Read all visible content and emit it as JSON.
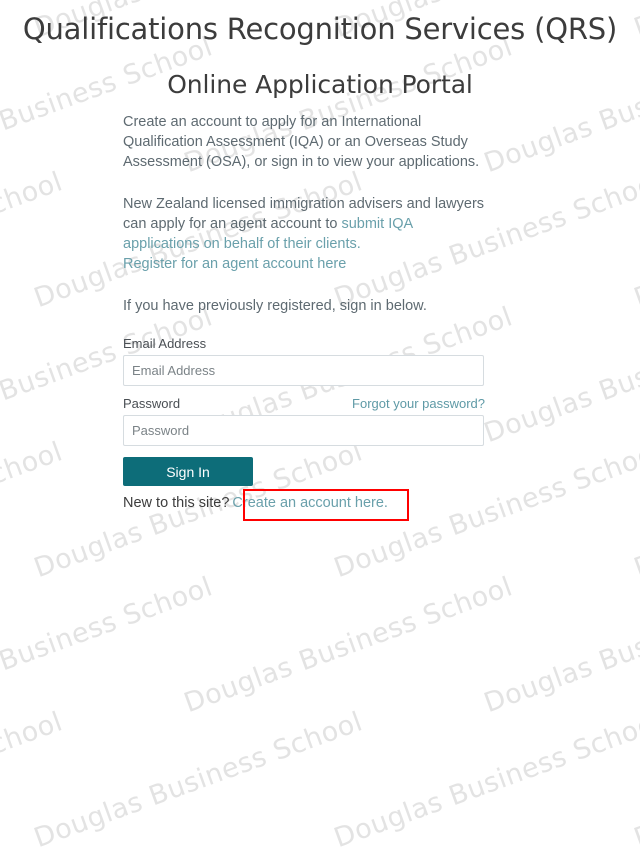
{
  "page": {
    "title": "Qualifications Recognition Services (QRS)",
    "subtitle": "Online Application Portal"
  },
  "content": {
    "intro_paragraph": "Create an account to apply for an International Qualification Assessment (IQA) or an Overseas Study Assessment (OSA), or sign in to view your applications.",
    "agent_paragraph_part1": "New Zealand licensed immigration advisers and lawyers can apply for an agent account to ",
    "agent_link_1": "submit IQA applications on behalf of their clients.",
    "agent_link_2": "Register for an agent account here",
    "signin_note": "If you have previously registered, sign in below."
  },
  "form": {
    "email": {
      "label": "Email Address",
      "placeholder": "Email Address",
      "value": ""
    },
    "password": {
      "label": "Password",
      "placeholder": "Password",
      "value": "",
      "forgot_link": "Forgot your password?"
    },
    "signin_button": "Sign In"
  },
  "signup": {
    "prompt": "New to this site?",
    "link": "Create an account here."
  },
  "watermark": {
    "text": "Douglas Business School"
  },
  "colors": {
    "accent_teal": "#0d6d79",
    "link_teal": "#6aa0ab",
    "body_text": "#5e6a71",
    "heading": "#3c3c3c",
    "annotation_red": "#ff0000",
    "input_border": "#d6dce0",
    "watermark_gray": "#e3e3e3"
  }
}
